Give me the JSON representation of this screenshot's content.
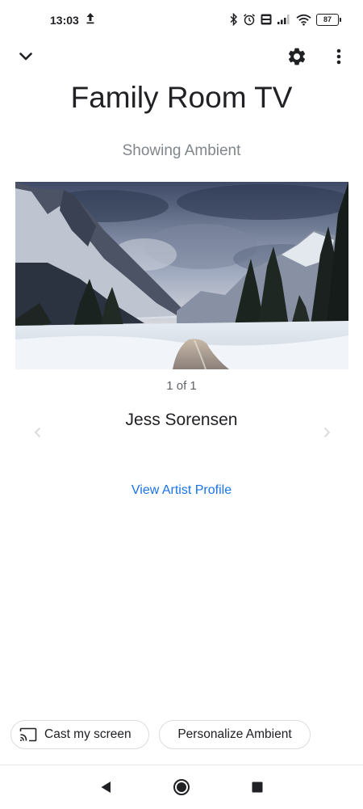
{
  "status_bar": {
    "time": "13:03",
    "battery": "87",
    "icons": [
      "upload-icon",
      "bluetooth-icon",
      "alarm-icon",
      "volte-icon",
      "signal-icon",
      "wifi-icon",
      "battery-icon"
    ]
  },
  "toolbar": {
    "icons": [
      "chevron-down-icon",
      "gear-icon",
      "more-vert-icon"
    ]
  },
  "device": {
    "title": "Family Room TV",
    "status": "Showing Ambient"
  },
  "photo": {
    "counter": "1 of 1",
    "artist": "Jess Sorensen",
    "profile_link": "View Artist Profile"
  },
  "actions": {
    "cast_label": "Cast my screen",
    "personalize_label": "Personalize Ambient"
  },
  "navigation": {
    "icons": [
      "back-icon",
      "home-icon",
      "recents-icon"
    ]
  },
  "colors": {
    "accent": "#1a73e8",
    "text": "#202124",
    "muted": "#80868b"
  }
}
